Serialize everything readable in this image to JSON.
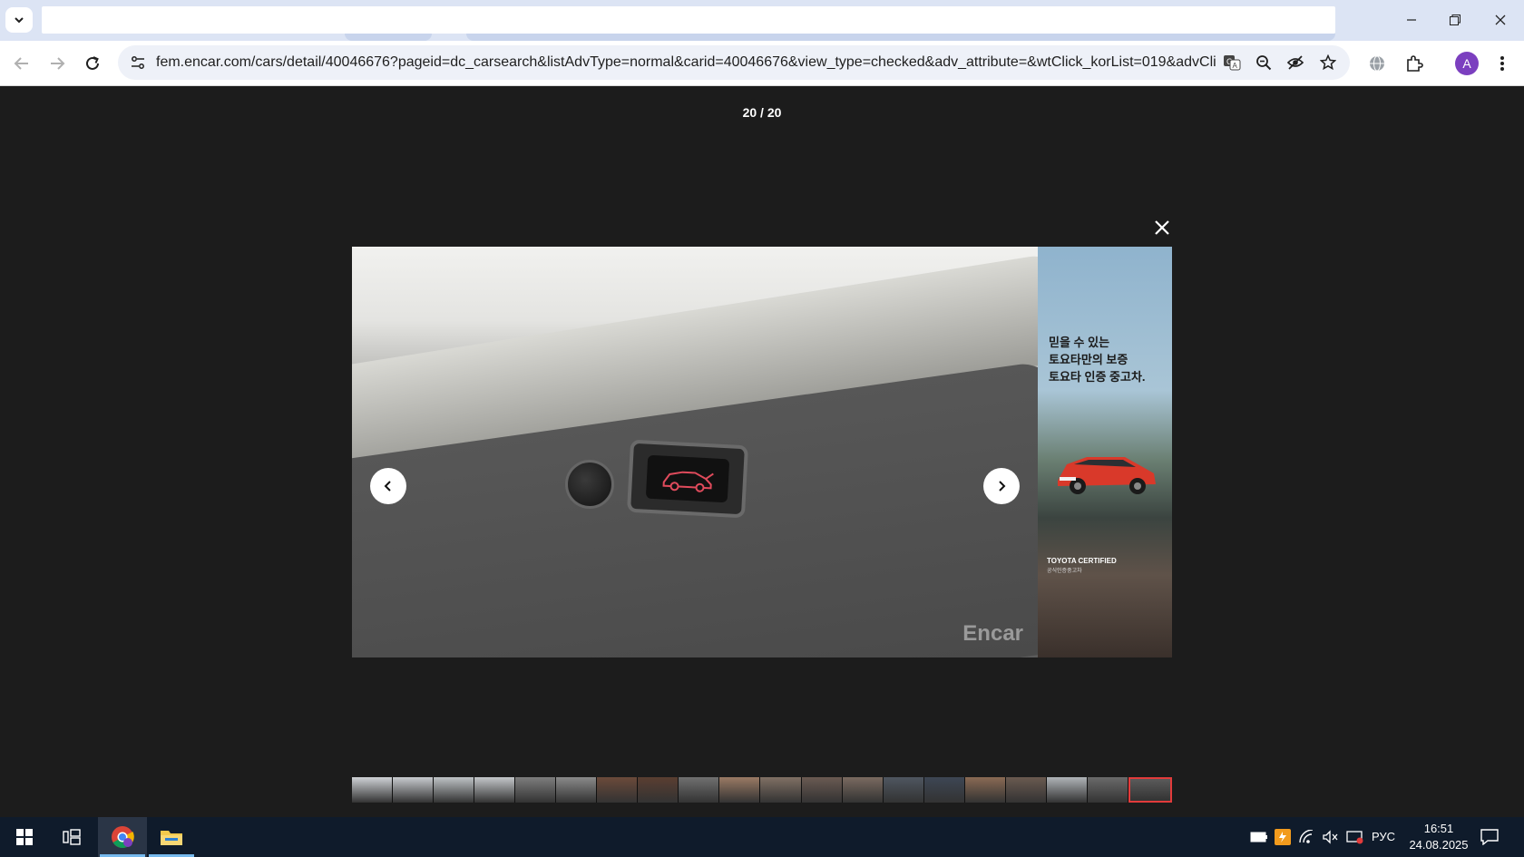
{
  "browser": {
    "url": "fem.encar.com/cars/detail/40046676?pageid=dc_carsearch&listAdvType=normal&carid=40046676&view_type=checked&adv_attribute=&wtClick_korList=019&advClickPo...",
    "profile_initial": "A"
  },
  "viewer": {
    "counter": "20 / 20",
    "watermark": "Encar",
    "ad": {
      "line1": "믿을 수 있는",
      "line2": "토요타만의 보증",
      "line3": "토요타 인증 중고차.",
      "brand": "TOYOTA CERTIFIED",
      "brand_sub": "공식인증중고차"
    },
    "thumbnails": [
      "1",
      "2",
      "3",
      "4",
      "5",
      "6",
      "7",
      "8",
      "9",
      "10",
      "11",
      "12",
      "13",
      "14",
      "15",
      "16",
      "17",
      "18",
      "19",
      "20"
    ],
    "thumbnail_colors": [
      "#cfd2d6",
      "#c8cbcf",
      "#bfc3c6",
      "#c4c7ca",
      "#7d7d7d",
      "#8a8a8a",
      "#6b4a3a",
      "#5a3e31",
      "#707070",
      "#9a7a64",
      "#807064",
      "#6a5a52",
      "#7a6a60",
      "#4f5660",
      "#3d4654",
      "#8a6a54",
      "#6a5a50",
      "#b0b4b8",
      "#6a6a6a",
      "#5a5a5a"
    ]
  },
  "taskbar": {
    "language": "РУС",
    "time": "16:51",
    "date": "24.08.2025"
  },
  "colors": {
    "accent_active_thumb": "#e23b3b",
    "viewer_bg": "#1c1c1c",
    "taskbar_bg": "#0f1b2b"
  }
}
